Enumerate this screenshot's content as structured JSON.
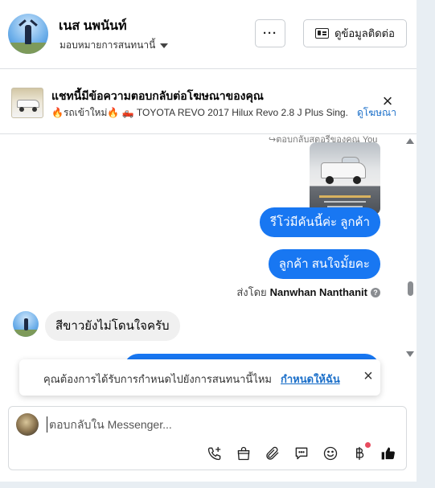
{
  "header": {
    "contact_name": "เนส นพนันท์",
    "assign_label": "มอบหมายการสนทนานี้",
    "more_label": "···",
    "contact_info_label": "ดูข้อมูลติดต่อ"
  },
  "ad_banner": {
    "title": "แชทนี้มีข้อความตอบกลับต่อโฆษณาของคุณ",
    "subtitle": "🔥รถเข้าใหม่🔥 🛻 TOYOTA REVO 2017 Hilux Revo 2.8 J Plus Sing...",
    "view_ad_link": "ดูโฆษณา",
    "close_label": "×"
  },
  "chat": {
    "reply_note": "↪ตอบกลับสตอรี่ของคุณ You",
    "messages_out": [
      "รีโว่มีคันนี้ค่ะ  ลูกค้า",
      "ลูกค้า สนใจมั้ยคะ"
    ],
    "sent_by_prefix": "ส่งโดย",
    "sent_by_name": "Nanwhan Nanthanit",
    "message_in": "สีขาวยังไม่โดนใจครับ"
  },
  "toast": {
    "text": "คุณต้องการได้รับการกำหนดไปยังการสนทนานี้ไหม",
    "link": "กำหนดให้ฉัน",
    "close_label": "×"
  },
  "composer": {
    "placeholder": "ตอบกลับใน Messenger...",
    "value": ""
  },
  "icons": {
    "tools": [
      "phone-add-icon",
      "shopping-bag-icon",
      "paperclip-icon",
      "saved-replies-icon",
      "emoji-icon",
      "baht-icon",
      "thumbs-up-icon"
    ]
  },
  "colors": {
    "accent": "#1877f2",
    "link": "#1b6fc9",
    "incoming_bubble": "#f0f0f0",
    "notification_dot": "#e84c5f"
  }
}
